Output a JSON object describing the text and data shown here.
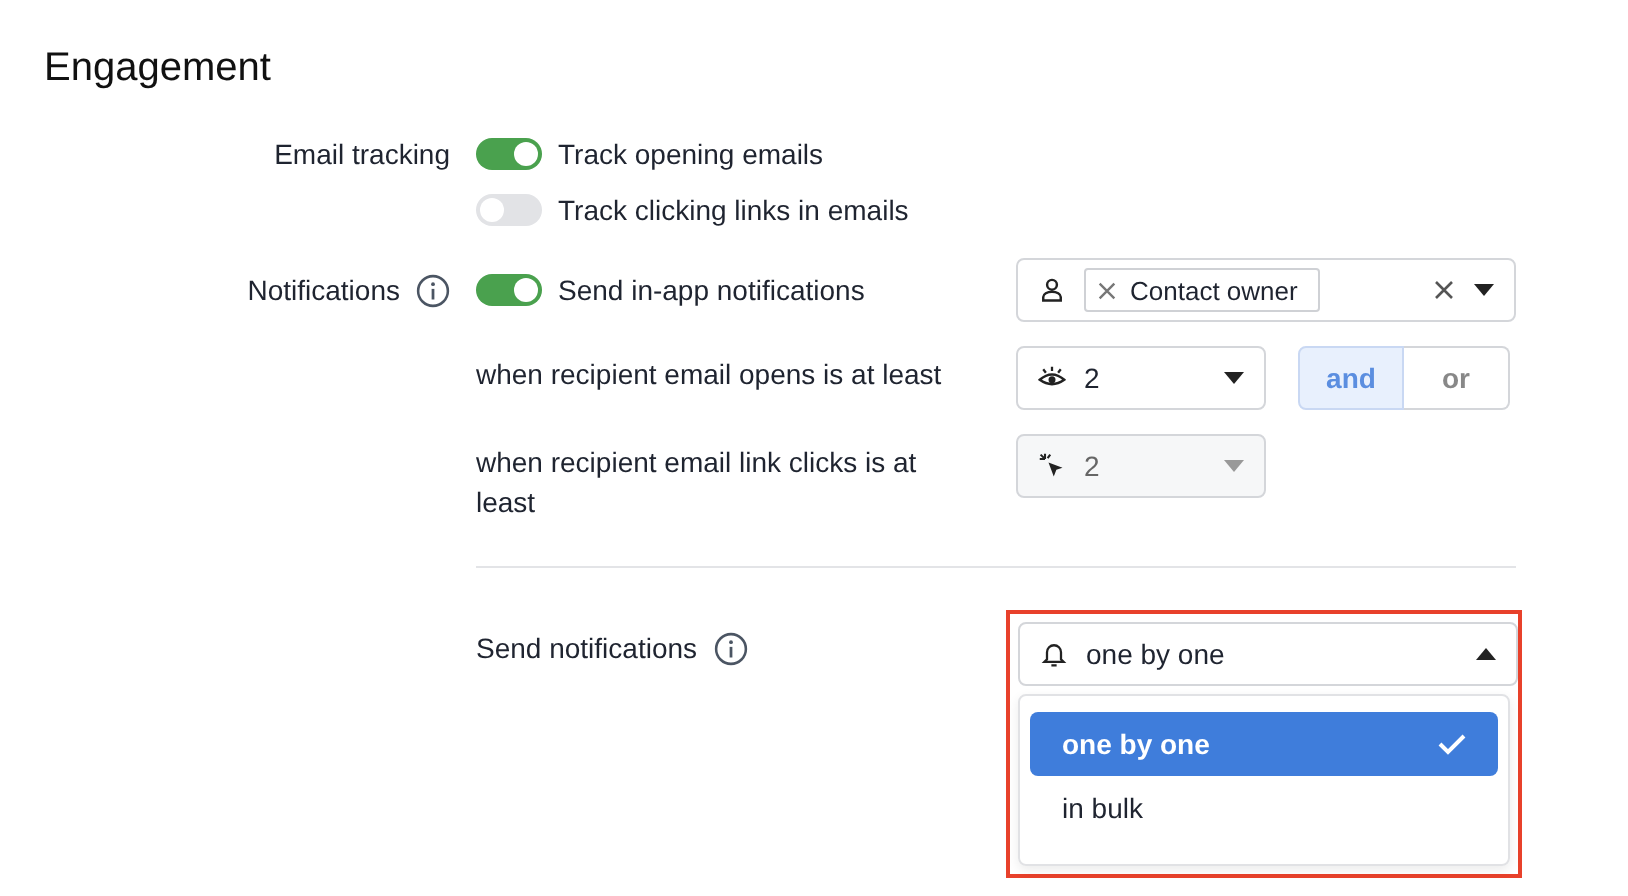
{
  "title": "Engagement",
  "email_tracking": {
    "label": "Email tracking",
    "options": [
      {
        "label": "Track opening emails",
        "on": true
      },
      {
        "label": "Track clicking links in emails",
        "on": false
      }
    ]
  },
  "notifications": {
    "label": "Notifications",
    "toggle": {
      "label": "Send in-app notifications",
      "on": true
    },
    "recipients": {
      "chips": [
        "Contact owner"
      ]
    },
    "conditions": [
      {
        "kind": "opens",
        "label": "when recipient email opens is at least",
        "value": "2",
        "disabled": false,
        "operators": [
          {
            "label": "and",
            "selected": true
          },
          {
            "label": "or",
            "selected": false
          }
        ]
      },
      {
        "kind": "clicks",
        "label": "when recipient email link clicks is at least",
        "value": "2",
        "disabled": true
      }
    ]
  },
  "send_notifications": {
    "label": "Send notifications",
    "value": "one by one",
    "expanded": true,
    "highlighted": true,
    "options": [
      {
        "label": "one by one",
        "selected": true
      },
      {
        "label": "in bulk",
        "selected": false
      }
    ]
  }
}
